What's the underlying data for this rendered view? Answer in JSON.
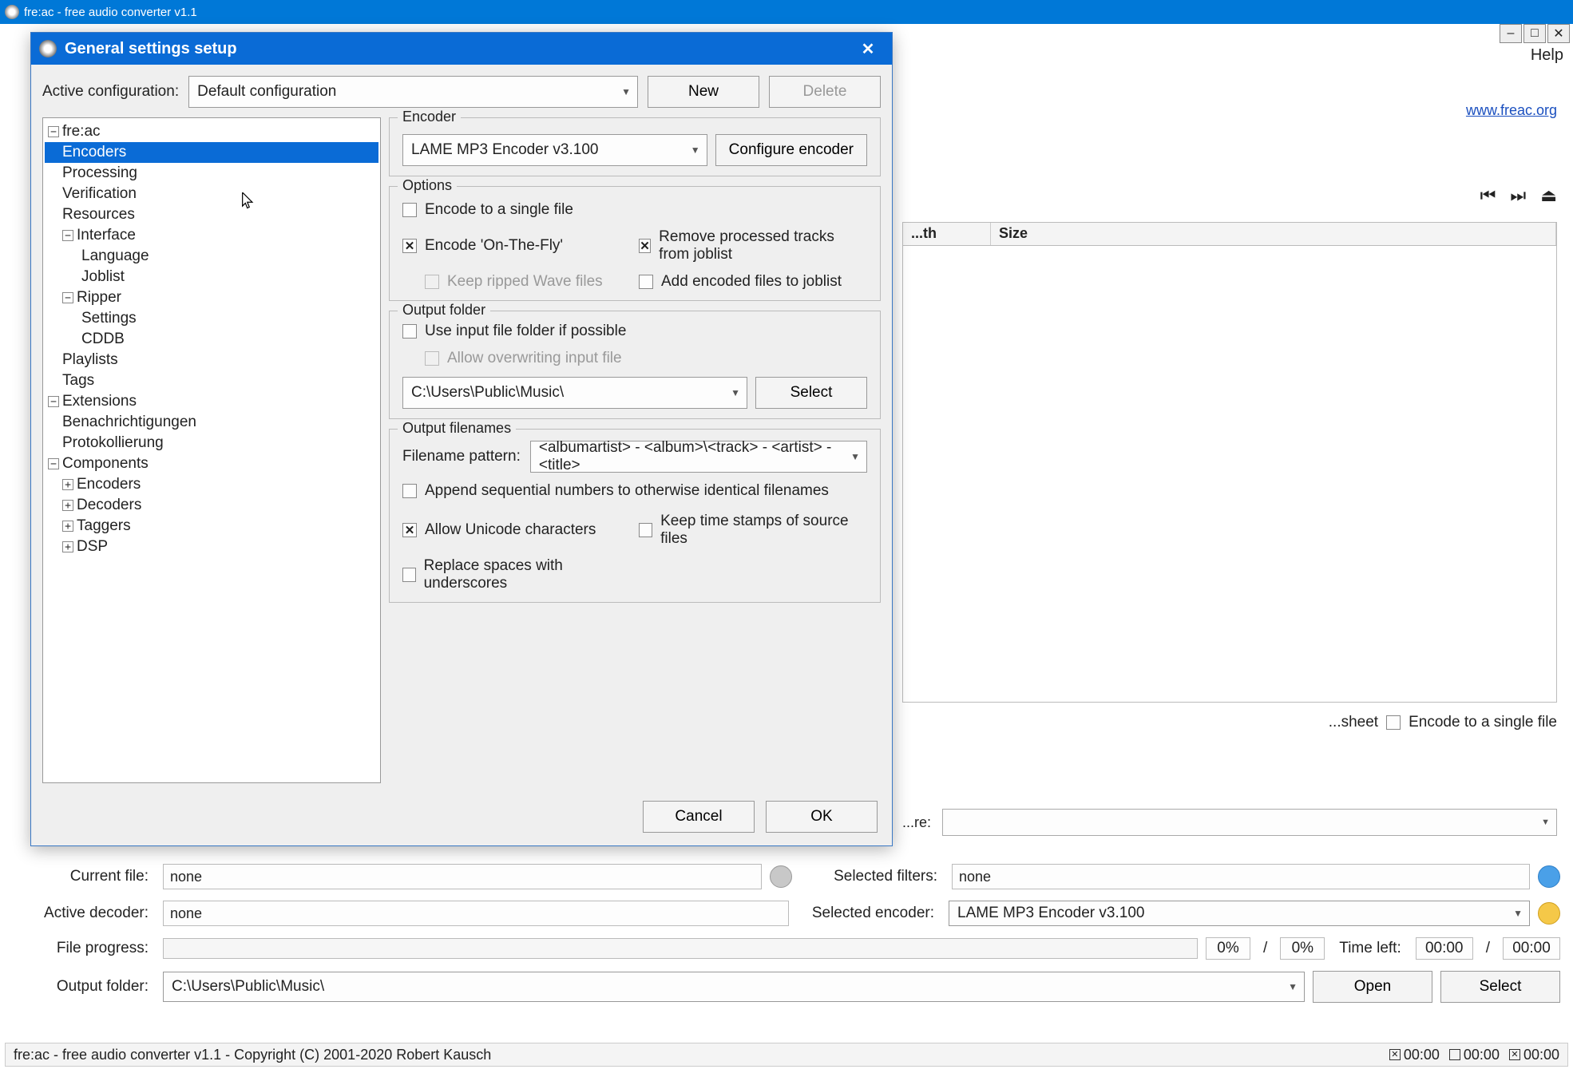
{
  "main_window": {
    "title": "fre:ac - free audio converter v1.1",
    "help_menu": "Help",
    "link": "www.freac.org",
    "list_columns": {
      "length": "...th",
      "size": "Size"
    },
    "bg_encode_single": "Encode to a single file",
    "bg_sheet": "...sheet",
    "bg_genre_label": "...re:"
  },
  "bottom": {
    "current_file_label": "Current file:",
    "current_file_value": "none",
    "active_decoder_label": "Active decoder:",
    "active_decoder_value": "none",
    "selected_filters_label": "Selected filters:",
    "selected_filters_value": "none",
    "selected_encoder_label": "Selected encoder:",
    "selected_encoder_value": "LAME MP3 Encoder v3.100",
    "file_progress_label": "File progress:",
    "pct1": "0%",
    "pct2": "0%",
    "time_left_label": "Time left:",
    "time1": "00:00",
    "time2": "00:00",
    "output_folder_label": "Output folder:",
    "output_folder_value": "C:\\Users\\Public\\Music\\",
    "open_btn": "Open",
    "select_btn": "Select"
  },
  "statusbar": {
    "text": "fre:ac - free audio converter v1.1 - Copyright (C) 2001-2020 Robert Kausch",
    "t1": "00:00",
    "t2": "00:00",
    "t3": "00:00"
  },
  "dialog": {
    "title": "General settings setup",
    "active_config_label": "Active configuration:",
    "active_config_value": "Default configuration",
    "new_btn": "New",
    "delete_btn": "Delete",
    "tree": {
      "root": "fre:ac",
      "encoders": "Encoders",
      "processing": "Processing",
      "verification": "Verification",
      "resources": "Resources",
      "interface": "Interface",
      "language": "Language",
      "joblist": "Joblist",
      "ripper": "Ripper",
      "settings": "Settings",
      "cddb": "CDDB",
      "playlists": "Playlists",
      "tags": "Tags",
      "extensions": "Extensions",
      "benach": "Benachrichtigungen",
      "protokoll": "Protokollierung",
      "components": "Components",
      "c_encoders": "Encoders",
      "c_decoders": "Decoders",
      "c_taggers": "Taggers",
      "c_dsp": "DSP"
    },
    "encoder": {
      "legend": "Encoder",
      "value": "LAME MP3 Encoder v3.100",
      "configure_btn": "Configure encoder"
    },
    "options": {
      "legend": "Options",
      "encode_single": "Encode to a single file",
      "encode_fly": "Encode 'On-The-Fly'",
      "keep_wave": "Keep ripped Wave files",
      "remove_processed": "Remove processed tracks from joblist",
      "add_encoded": "Add encoded files to joblist"
    },
    "output_folder": {
      "legend": "Output folder",
      "use_input": "Use input file folder if possible",
      "allow_overwrite": "Allow overwriting input file",
      "path": "C:\\Users\\Public\\Music\\",
      "select_btn": "Select"
    },
    "output_filenames": {
      "legend": "Output filenames",
      "pattern_label": "Filename pattern:",
      "pattern_value": "<albumartist> - <album>\\<track> - <artist> - <title>",
      "append_seq": "Append sequential numbers to otherwise identical filenames",
      "allow_unicode": "Allow Unicode characters",
      "keep_timestamps": "Keep time stamps of source files",
      "replace_spaces": "Replace spaces with underscores"
    },
    "cancel_btn": "Cancel",
    "ok_btn": "OK"
  }
}
